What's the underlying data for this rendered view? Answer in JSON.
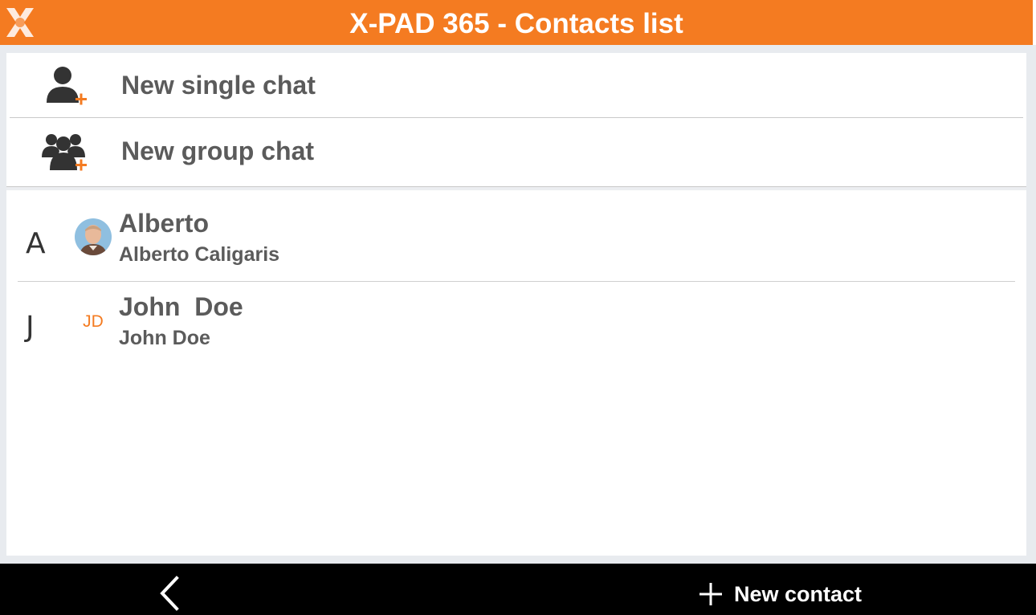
{
  "header": {
    "title": "X-PAD 365 - Contacts list",
    "logo_icon": "x-pad-logo-icon",
    "accent_color": "#f47b21"
  },
  "actions": [
    {
      "label": "New single chat",
      "icon": "add-user-icon"
    },
    {
      "label": "New group chat",
      "icon": "add-group-icon"
    }
  ],
  "contacts": [
    {
      "index_letter": "A",
      "name": "Alberto",
      "full_name": "Alberto Caligaris",
      "avatar": "photo"
    },
    {
      "index_letter": "J",
      "name": "John  Doe",
      "full_name": "John Doe",
      "initials": "JD"
    }
  ],
  "bottom_bar": {
    "back_icon": "chevron-left-icon",
    "new_contact_label": "New contact",
    "new_contact_icon": "plus-icon"
  }
}
